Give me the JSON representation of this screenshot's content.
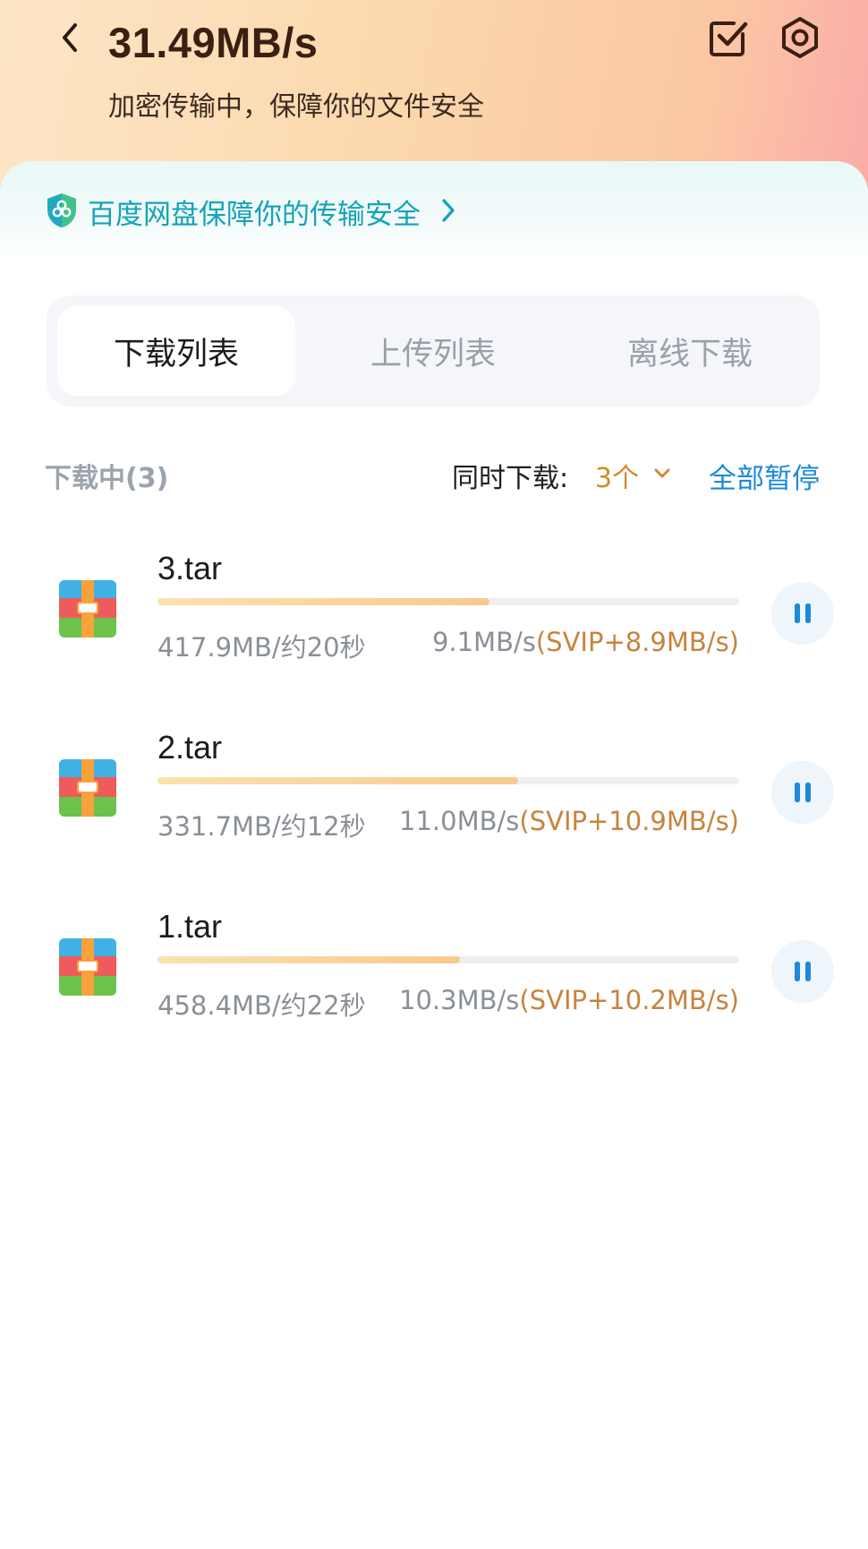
{
  "header": {
    "speed": "31.49MB/s",
    "subtitle": "加密传输中，保障你的文件安全",
    "icons": [
      "back-arrow-icon",
      "checkbox-icon",
      "settings-icon"
    ]
  },
  "banner": {
    "text": "百度网盘保障你的传输安全",
    "icons": [
      "shield-icon",
      "chevron-right-icon"
    ]
  },
  "tabs": [
    {
      "label": "下载列表",
      "active": true
    },
    {
      "label": "上传列表",
      "active": false
    },
    {
      "label": "离线下载",
      "active": false
    }
  ],
  "section": {
    "downloading_label": "下载中(3)",
    "concurrent_label": "同时下载:",
    "concurrent_value": "3个",
    "pause_all": "全部暂停"
  },
  "downloads": [
    {
      "name": "3.tar",
      "size_eta": "417.9MB/约20秒",
      "rate": "9.1MB/s",
      "svip": "(SVIP+8.9MB/s)",
      "progress": 0.57
    },
    {
      "name": "2.tar",
      "size_eta": "331.7MB/约12秒",
      "rate": "11.0MB/s",
      "svip": "(SVIP+10.9MB/s)",
      "progress": 0.62
    },
    {
      "name": "1.tar",
      "size_eta": "458.4MB/约22秒",
      "rate": "10.3MB/s",
      "svip": "(SVIP+10.2MB/s)",
      "progress": 0.52
    }
  ],
  "colors": {
    "accent_blue": "#1b8ad8",
    "banner_teal": "#14a3b8",
    "svip_gold": "#c7833d",
    "progress_fill": "#f8c98e"
  }
}
